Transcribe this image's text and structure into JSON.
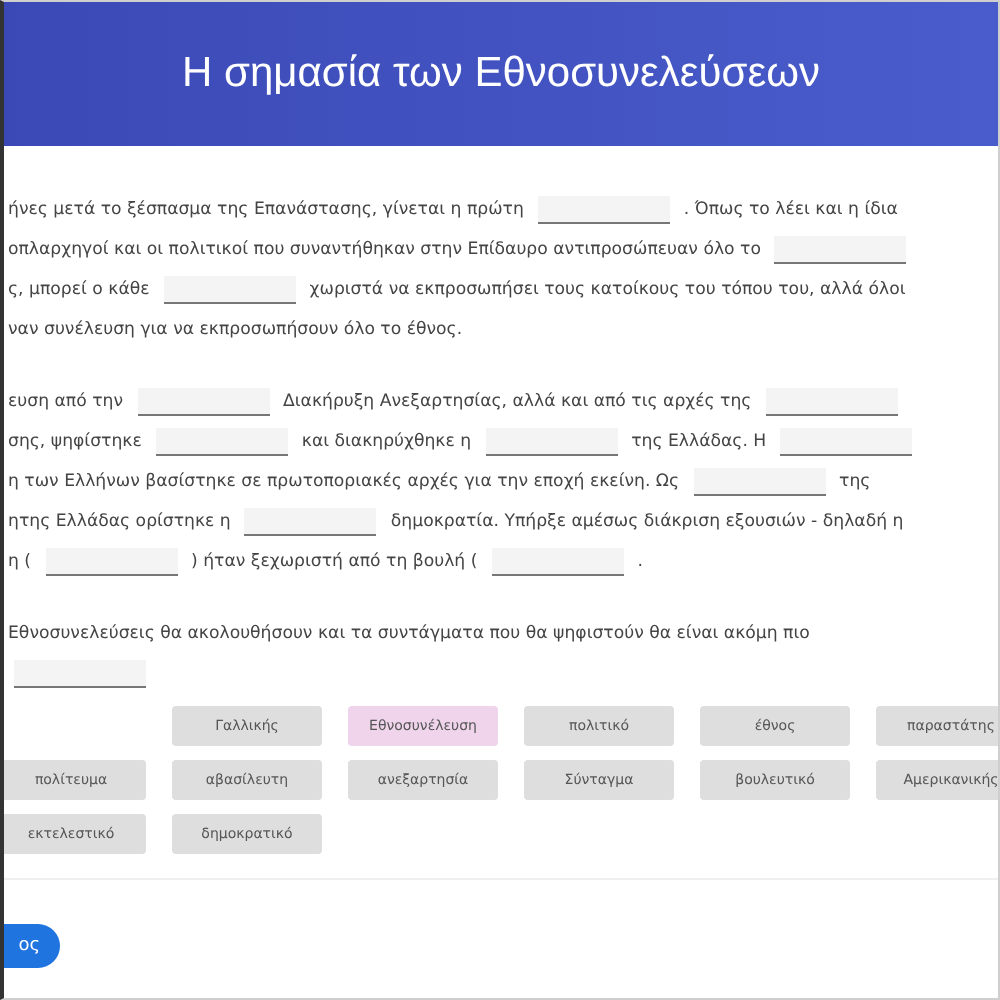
{
  "header": {
    "title": "Η σημασία των Εθνοσυνελεύσεων"
  },
  "paragraphs": [
    {
      "lines": [
        [
          {
            "kind": "text",
            "text": "ήνες μετά το ξέσπασμα της Επανάστασης, γίνεται η πρώτη"
          },
          {
            "kind": "blank"
          },
          {
            "kind": "text",
            "text": ". Όπως το λέει και η ίδια"
          }
        ],
        [
          {
            "kind": "text",
            "text": "οπλαρχηγοί και οι πολιτικοί που συναντήθηκαν στην Επίδαυρο αντιπροσώπευαν όλο το"
          },
          {
            "kind": "blank"
          }
        ],
        [
          {
            "kind": "text",
            "text": "ς, μπορεί ο κάθε"
          },
          {
            "kind": "blank"
          },
          {
            "kind": "text",
            "text": "χωριστά να εκπροσωπήσει τους κατοίκους του τόπου του, αλλά όλοι"
          }
        ],
        [
          {
            "kind": "text",
            "text": "ναν συνέλευση για να εκπροσωπήσουν όλο το έθνος."
          }
        ]
      ]
    },
    {
      "lines": [
        [
          {
            "kind": "text",
            "text": "ευση από την"
          },
          {
            "kind": "blank"
          },
          {
            "kind": "text",
            "text": "Διακήρυξη Ανεξαρτησίας, αλλά και από τις αρχές της"
          },
          {
            "kind": "blank"
          }
        ],
        [
          {
            "kind": "text",
            "text": "σης, ψηφίστηκε"
          },
          {
            "kind": "blank"
          },
          {
            "kind": "text",
            "text": "και διακηρύχθηκε η"
          },
          {
            "kind": "blank"
          },
          {
            "kind": "text",
            "text": "της Ελλάδας. Η"
          },
          {
            "kind": "blank"
          }
        ],
        [
          {
            "kind": "text",
            "text": "η των Ελλήνων βασίστηκε σε πρωτοποριακές αρχές για την εποχή εκείνη. Ως"
          },
          {
            "kind": "blank"
          },
          {
            "kind": "text",
            "text": "της"
          }
        ],
        [
          {
            "kind": "text",
            "text": "ητης Ελλάδας ορίστηκε η"
          },
          {
            "kind": "blank"
          },
          {
            "kind": "text",
            "text": "δημοκρατία. Υπήρξε αμέσως διάκριση εξουσιών - δηλαδή η"
          }
        ],
        [
          {
            "kind": "text",
            "text": "η ("
          },
          {
            "kind": "blank"
          },
          {
            "kind": "text",
            "text": ") ήταν ξεχωριστή από τη βουλή ("
          },
          {
            "kind": "blank"
          },
          {
            "kind": "text",
            "text": "."
          }
        ]
      ]
    },
    {
      "lines": [
        [
          {
            "kind": "text",
            "text": "Εθνοσυνελεύσεις θα ακολουθήσουν και τα συντάγματα που θα ψηφιστούν θα είναι ακόμη πιο"
          }
        ],
        [
          {
            "kind": "blank"
          }
        ]
      ]
    }
  ],
  "word_bank": [
    {
      "label": "Γαλλικής",
      "selected": false
    },
    {
      "label": "Εθνοσυνέλευση",
      "selected": true
    },
    {
      "label": "πολιτικό",
      "selected": false
    },
    {
      "label": "έθνος",
      "selected": false
    },
    {
      "label": "παραστάτης",
      "selected": false
    },
    {
      "label": "πολίτευμα",
      "selected": false
    },
    {
      "label": "αβασίλευτη",
      "selected": false
    },
    {
      "label": "ανεξαρτησία",
      "selected": false
    },
    {
      "label": "Σύνταγμα",
      "selected": false
    },
    {
      "label": "βουλευτικό",
      "selected": false
    },
    {
      "label": "Αμερικανικής",
      "selected": false
    },
    {
      "label": "εκτελεστικό",
      "selected": false
    },
    {
      "label": "δημοκρατικό",
      "selected": false
    }
  ],
  "button": {
    "label": "ος"
  }
}
